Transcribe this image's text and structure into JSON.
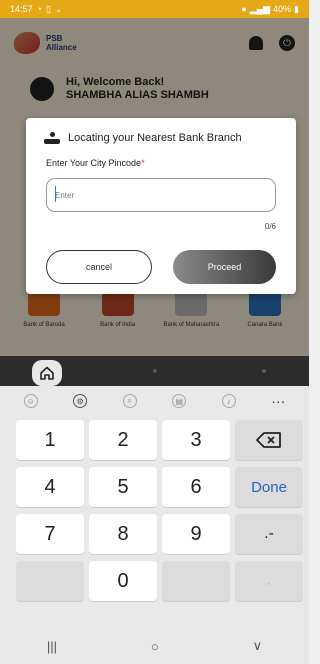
{
  "status_bar": {
    "time": "14:57",
    "left_icons": [
      "whatsapp-icon",
      "sim-icon",
      "location-icon"
    ],
    "right_text": "40%"
  },
  "app": {
    "brand_line1": "PSB",
    "brand_line2": "Alliance",
    "welcome_line1": "Hi, Welcome Back!",
    "welcome_line2": "SHAMBHA ALIAS SHAMBH",
    "banks": [
      {
        "name": "Bank of Baroda",
        "color": "#e06a1a"
      },
      {
        "name": "Bank of India",
        "color": "#c0452a"
      },
      {
        "name": "Bank of Maharashtra",
        "color": "#b9b9b9"
      },
      {
        "name": "Canara Bank",
        "color": "#2a70b8"
      }
    ]
  },
  "dialog": {
    "title": "Locating your Nearest Bank Branch",
    "label": "Enter Your City Pincode",
    "required_mark": "*",
    "input_value": "",
    "input_placeholder": "Enter",
    "counter": "0/6",
    "cancel_label": "cancel",
    "proceed_label": "Proceed"
  },
  "keyboard": {
    "toolbar": [
      "emoji-icon",
      "settings-icon",
      "search-icon",
      "clipboard-icon",
      "mic-icon",
      "more-icon"
    ],
    "more_label": "···",
    "row1": [
      "1",
      "2",
      "3"
    ],
    "row2": [
      "4",
      "5",
      "6"
    ],
    "done_label": "Done",
    "row3": [
      "7",
      "8",
      "9"
    ],
    "row3_symbols": ".-",
    "row4_zero": "0",
    "row4_comma": ","
  },
  "system_nav": {
    "recents": "|||",
    "home": "○",
    "back": "∨"
  }
}
